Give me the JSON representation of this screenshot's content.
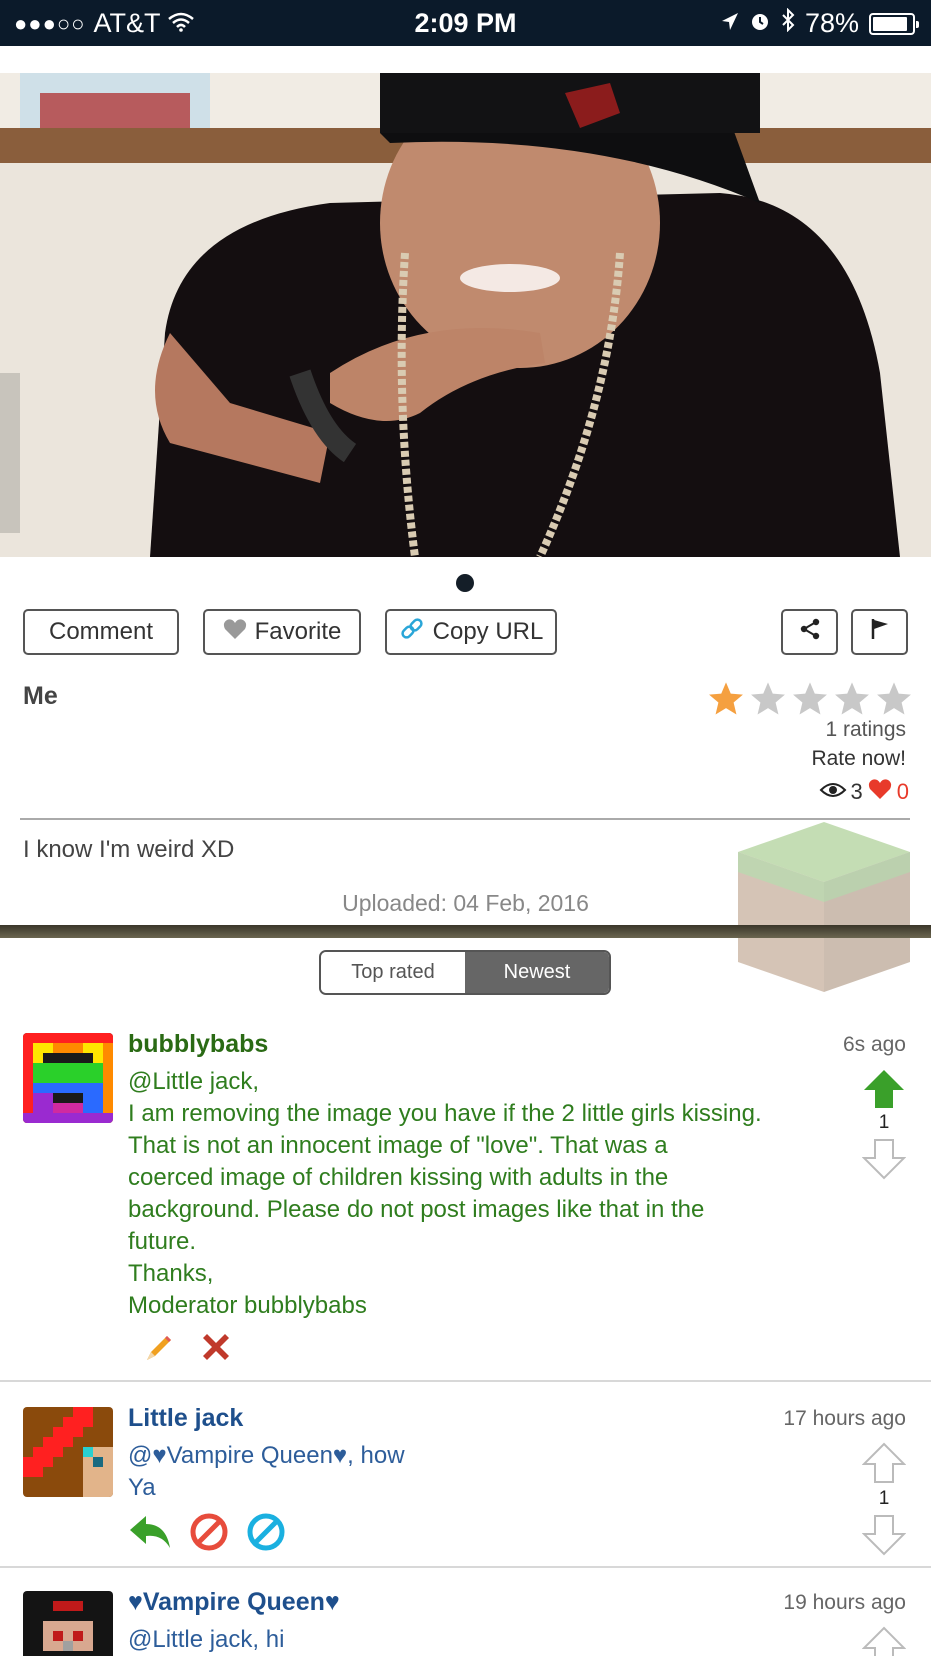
{
  "status_bar": {
    "signal": "●●●○○",
    "carrier": "AT&T",
    "time": "2:09 PM",
    "battery": "78%"
  },
  "actions": {
    "comment": "Comment",
    "favorite": "Favorite",
    "copy_url": "Copy URL"
  },
  "image_info": {
    "title": "Me",
    "rating": 1,
    "max_rating": 5,
    "ratings_count": "1 ratings",
    "rate_now": "Rate now!",
    "views": "3",
    "likes": "0",
    "description": "I know I'm weird XD",
    "uploaded": "Uploaded: 04 Feb, 2016"
  },
  "sort": {
    "top_rated": "Top rated",
    "newest": "Newest",
    "selected": "Newest"
  },
  "colors": {
    "moderator_text": "#2f7d1e",
    "user_text": "#2d5d9a",
    "upvote_active": "#3aa02a",
    "heart": "#e83a2a"
  },
  "comments": [
    {
      "author": "bubblybabs",
      "time": "6s ago",
      "lines": [
        "@Little jack,",
        "I am removing the image you have if the 2 little girls kissing.",
        "That is not an innocent image of \"love\". That was a",
        "coerced image of children kissing with adults in the",
        "background. Please do not post images like that in the",
        "future.",
        "Thanks,",
        "Moderator bubblybabs"
      ],
      "votes": "1",
      "actions": [
        "pencil-icon",
        "delete-x-icon"
      ]
    },
    {
      "author": "Little jack",
      "time": "17 hours ago",
      "lines": [
        "@♥Vampire Queen♥, how",
        "Ya"
      ],
      "votes": "1",
      "actions": [
        "reply-icon",
        "block-red-icon",
        "block-blue-icon"
      ]
    },
    {
      "author": "♥Vampire Queen♥",
      "time": "19 hours ago",
      "lines": [
        "@Little jack, hi"
      ]
    }
  ]
}
